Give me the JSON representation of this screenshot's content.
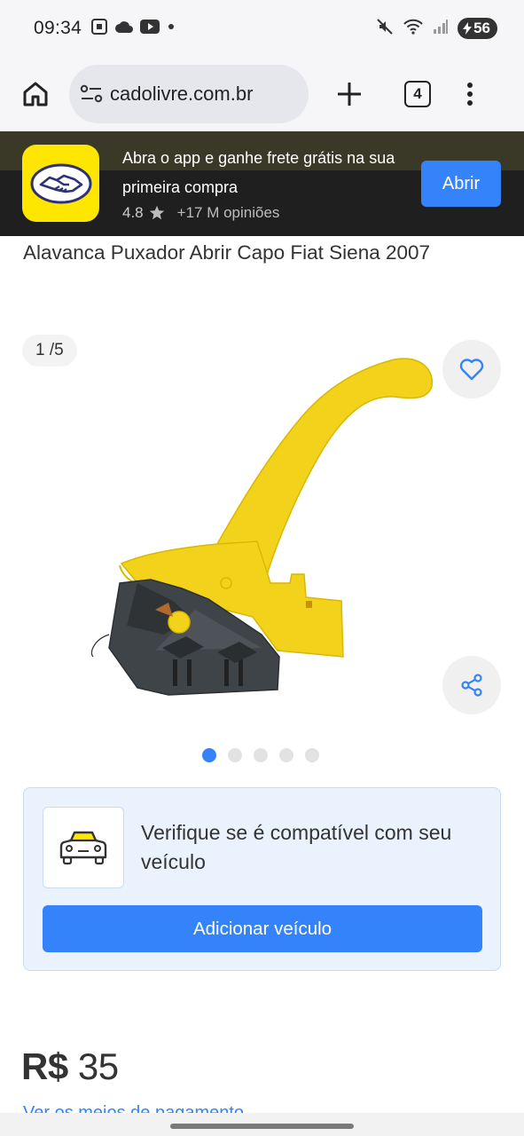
{
  "status_bar": {
    "time": "09:34",
    "battery": "56",
    "icons_left": [
      "screenshot-icon",
      "cloud-icon",
      "youtube-icon",
      "dot-icon"
    ],
    "icons_right": [
      "mute-icon",
      "wifi-icon",
      "signal-icon",
      "battery-icon"
    ]
  },
  "browser": {
    "url": "cadolivre.com.br",
    "tab_count": "4"
  },
  "app_banner": {
    "message": "Abra o app e ganhe frete grátis na sua primeira compra",
    "rating": "4.8",
    "reviews": "+17 M opiniões",
    "open_button": "Abrir",
    "brand_color": "#ffe600",
    "accent_color": "#3483fa"
  },
  "product": {
    "title": "Alavanca Puxador Abrir Capo Fiat Siena 2007",
    "gallery_counter": "1 /5",
    "image_count": 5,
    "active_image_index": 0
  },
  "compatibility": {
    "text": "Verifique se é compatível com seu veículo",
    "button": "Adicionar veículo"
  },
  "price": {
    "currency": "R$",
    "amount": "35",
    "payment_link": "Ver os meios de pagamento"
  }
}
